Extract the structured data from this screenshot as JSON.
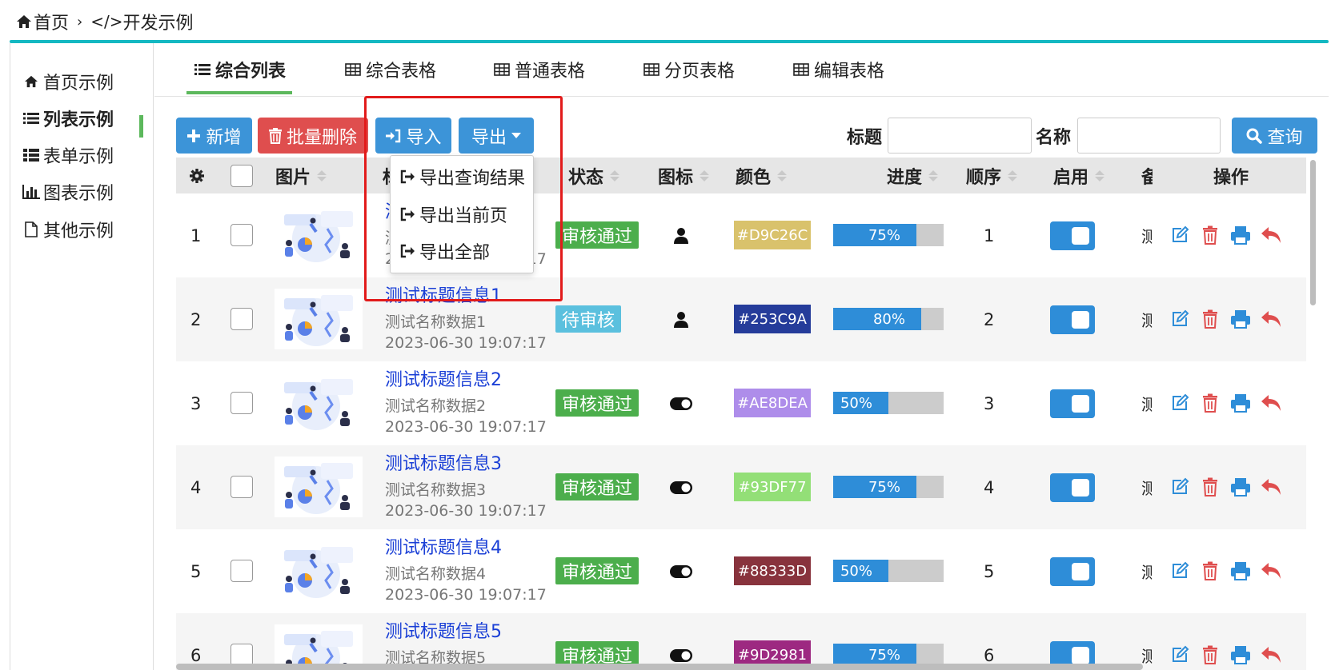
{
  "breadcrumb": {
    "home": "首页",
    "sep": "›",
    "current_prefix": "</>",
    "current": "开发示例"
  },
  "sidebar": {
    "items": [
      {
        "label": "首页示例",
        "icon": "home-icon"
      },
      {
        "label": "列表示例",
        "icon": "list-icon",
        "active": true
      },
      {
        "label": "表单示例",
        "icon": "th-list-icon"
      },
      {
        "label": "图表示例",
        "icon": "bar-chart-icon"
      },
      {
        "label": "其他示例",
        "icon": "file-icon"
      }
    ]
  },
  "tabs": [
    {
      "label": "综合列表",
      "icon": "list-icon",
      "active": true
    },
    {
      "label": "综合表格",
      "icon": "table-icon"
    },
    {
      "label": "普通表格",
      "icon": "table-icon"
    },
    {
      "label": "分页表格",
      "icon": "table-icon"
    },
    {
      "label": "编辑表格",
      "icon": "table-icon"
    }
  ],
  "toolbar": {
    "add": "新增",
    "batch_delete": "批量删除",
    "import": "导入",
    "export": "导出",
    "search_title_label": "标题",
    "search_name_label": "名称",
    "query": "查询"
  },
  "export_menu": {
    "items": [
      "导出查询结果",
      "导出当前页",
      "导出全部"
    ]
  },
  "table": {
    "headers": {
      "image": "图片",
      "title": "标题",
      "status": "状态",
      "icon": "图标",
      "color": "颜色",
      "progress": "进度",
      "order": "顺序",
      "enabled": "启用",
      "remark": "备注",
      "actions": "操作"
    },
    "rows": [
      {
        "index": "1",
        "title": "测试标题信息0",
        "name": "测试名称数据0",
        "time": "2023-06-30 19:07:17",
        "status": "审核通过",
        "status_type": "pass",
        "icon": "user-icon",
        "color": "#D9C26C",
        "progress": 75,
        "progress_label": "75%",
        "order": "1",
        "remark": "测试"
      },
      {
        "index": "2",
        "title": "测试标题信息1",
        "name": "测试名称数据1",
        "time": "2023-06-30 19:07:17",
        "status": "待审核",
        "status_type": "wait",
        "icon": "user-icon",
        "color": "#253C9A",
        "progress": 80,
        "progress_label": "80%",
        "order": "2",
        "remark": "测试"
      },
      {
        "index": "3",
        "title": "测试标题信息2",
        "name": "测试名称数据2",
        "time": "2023-06-30 19:07:17",
        "status": "审核通过",
        "status_type": "pass",
        "icon": "toggle-icon",
        "color": "#AE8DEA",
        "progress": 50,
        "progress_label": "50%",
        "order": "3",
        "remark": "测试"
      },
      {
        "index": "4",
        "title": "测试标题信息3",
        "name": "测试名称数据3",
        "time": "2023-06-30 19:07:17",
        "status": "审核通过",
        "status_type": "pass",
        "icon": "toggle-icon",
        "color": "#93DF77",
        "progress": 75,
        "progress_label": "75%",
        "order": "4",
        "remark": "测试"
      },
      {
        "index": "5",
        "title": "测试标题信息4",
        "name": "测试名称数据4",
        "time": "2023-06-30 19:07:17",
        "status": "审核通过",
        "status_type": "pass",
        "icon": "toggle-icon",
        "color": "#88333D",
        "progress": 50,
        "progress_label": "50%",
        "order": "5",
        "remark": "测试"
      },
      {
        "index": "6",
        "title": "测试标题信息5",
        "name": "测试名称数据5",
        "time": "2023-06-30 19:07:17",
        "status": "审核通过",
        "status_type": "pass",
        "icon": "toggle-icon",
        "color": "#9D2981",
        "progress": 75,
        "progress_label": "75%",
        "order": "6",
        "remark": "测试"
      }
    ]
  },
  "colors": {
    "primary": "#3c94d8",
    "danger": "#df4e4e",
    "success": "#4cae4c",
    "info": "#5bc0de",
    "teal": "#14b8c2",
    "title_link": "#1a3fd6",
    "highlight": "#e21b1b"
  }
}
